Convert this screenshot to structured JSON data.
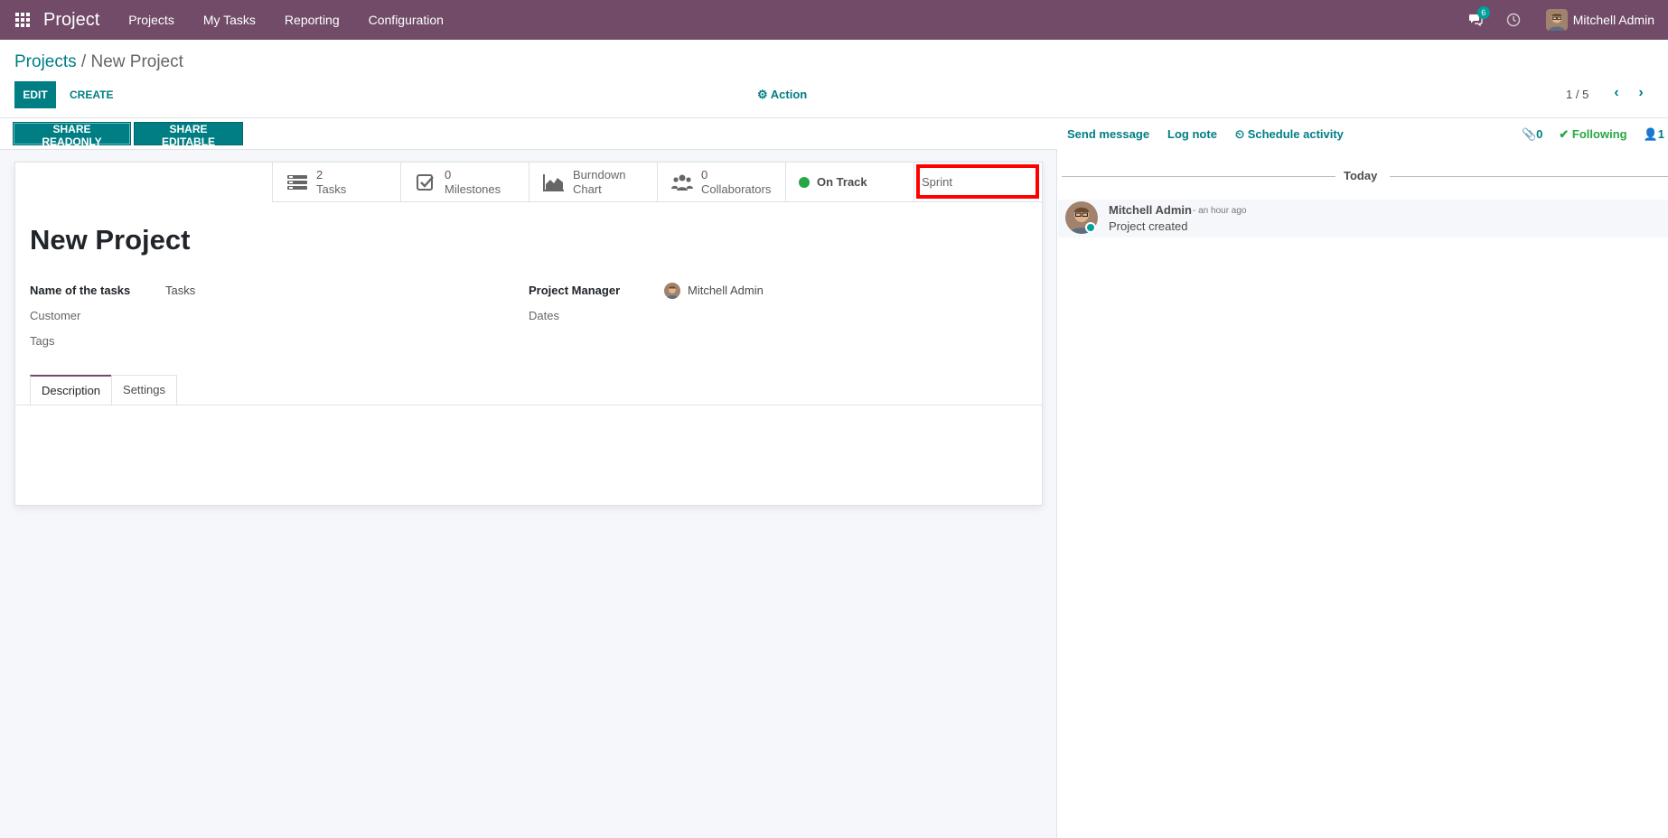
{
  "navbar": {
    "brand": "Project",
    "menu": [
      "Projects",
      "My Tasks",
      "Reporting",
      "Configuration"
    ],
    "messages_count": "6",
    "user_name": "Mitchell Admin"
  },
  "control_panel": {
    "breadcrumb_parent": "Projects",
    "breadcrumb_separator": " / ",
    "breadcrumb_current": "New Project",
    "edit_label": "EDIT",
    "create_label": "CREATE",
    "action_label": "Action",
    "pager": "1 / 5"
  },
  "statusbar": {
    "share_readonly": "SHARE READONLY",
    "share_editable": "SHARE EDITABLE"
  },
  "stat_buttons": {
    "tasks": {
      "value": "2",
      "label": "Tasks"
    },
    "milestones": {
      "value": "0",
      "label": "Milestones"
    },
    "burndown": {
      "line1": "Burndown",
      "line2": "Chart"
    },
    "collaborators": {
      "value": "0",
      "label": "Collaborators"
    },
    "status": {
      "label": "On Track",
      "color": "#28a745"
    },
    "sprint": {
      "label": "Sprint"
    }
  },
  "form": {
    "title": "New Project",
    "fields": {
      "name_of_tasks_label": "Name of the tasks",
      "name_of_tasks_value": "Tasks",
      "customer_label": "Customer",
      "tags_label": "Tags",
      "project_manager_label": "Project Manager",
      "project_manager_value": "Mitchell Admin",
      "dates_label": "Dates"
    },
    "tabs": [
      "Description",
      "Settings"
    ]
  },
  "chatter": {
    "send_message": "Send message",
    "log_note": "Log note",
    "schedule_activity": "Schedule activity",
    "attachments_count": "0",
    "following": "Following",
    "followers_count": "1",
    "separator": "Today",
    "message": {
      "author": "Mitchell Admin",
      "time": "- an hour ago",
      "body": "Project created"
    }
  },
  "colors": {
    "brand": "#714b67",
    "accent": "#017e84",
    "success": "#28a745",
    "highlight": "#ff0000"
  }
}
